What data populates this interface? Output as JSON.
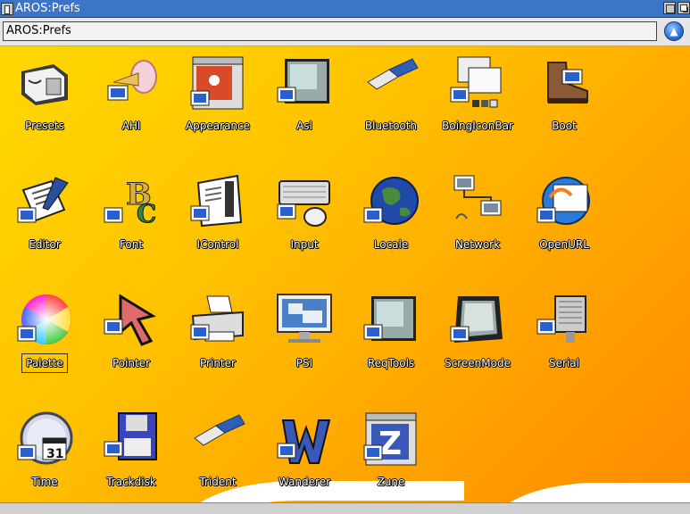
{
  "window": {
    "title": "AROS:Prefs"
  },
  "pathbar": {
    "path": "AROS:Prefs",
    "go_icon": "arrow-up-icon"
  },
  "icons": [
    {
      "label": "Presets",
      "icon": "presets-drawer-icon"
    },
    {
      "label": "AHI",
      "icon": "horn-speaker-icon"
    },
    {
      "label": "Appearance",
      "icon": "appearance-window-icon"
    },
    {
      "label": "Asl",
      "icon": "file-requester-icon"
    },
    {
      "label": "Bluetooth",
      "icon": "usb-stick-icon"
    },
    {
      "label": "BoingIconBar",
      "icon": "icon-bar-windows-icon"
    },
    {
      "label": "Boot",
      "icon": "boot-icon"
    },
    {
      "label": "Editor",
      "icon": "clipboard-pen-icon"
    },
    {
      "label": "Font",
      "icon": "font-letters-icon"
    },
    {
      "label": "IControl",
      "icon": "window-controls-icon"
    },
    {
      "label": "Input",
      "icon": "keyboard-mouse-icon"
    },
    {
      "label": "Locale",
      "icon": "globe-icon"
    },
    {
      "label": "Network",
      "icon": "network-computers-icon"
    },
    {
      "label": "OpenURL",
      "icon": "open-url-icon"
    },
    {
      "label": "Palette",
      "icon": "color-wheel-icon"
    },
    {
      "label": "Pointer",
      "icon": "pointer-arrow-icon"
    },
    {
      "label": "Printer",
      "icon": "printer-icon"
    },
    {
      "label": "PSI",
      "icon": "monitor-screen-icon"
    },
    {
      "label": "ReqTools",
      "icon": "requester-tools-icon"
    },
    {
      "label": "ScreenMode",
      "icon": "crt-monitor-icon"
    },
    {
      "label": "Serial",
      "icon": "serial-connector-icon"
    },
    {
      "label": "Time",
      "icon": "clock-calendar-icon"
    },
    {
      "label": "Trackdisk",
      "icon": "floppy-disk-icon"
    },
    {
      "label": "Trident",
      "icon": "usb-plug-icon"
    },
    {
      "label": "Wanderer",
      "icon": "wanderer-w-icon"
    },
    {
      "label": "Zune",
      "icon": "zune-z-icon"
    }
  ],
  "selected_icon": "Palette",
  "colors": {
    "title_bar": "#3c74c6",
    "desktop_start": "#ffd800",
    "desktop_end": "#ff8a00"
  }
}
